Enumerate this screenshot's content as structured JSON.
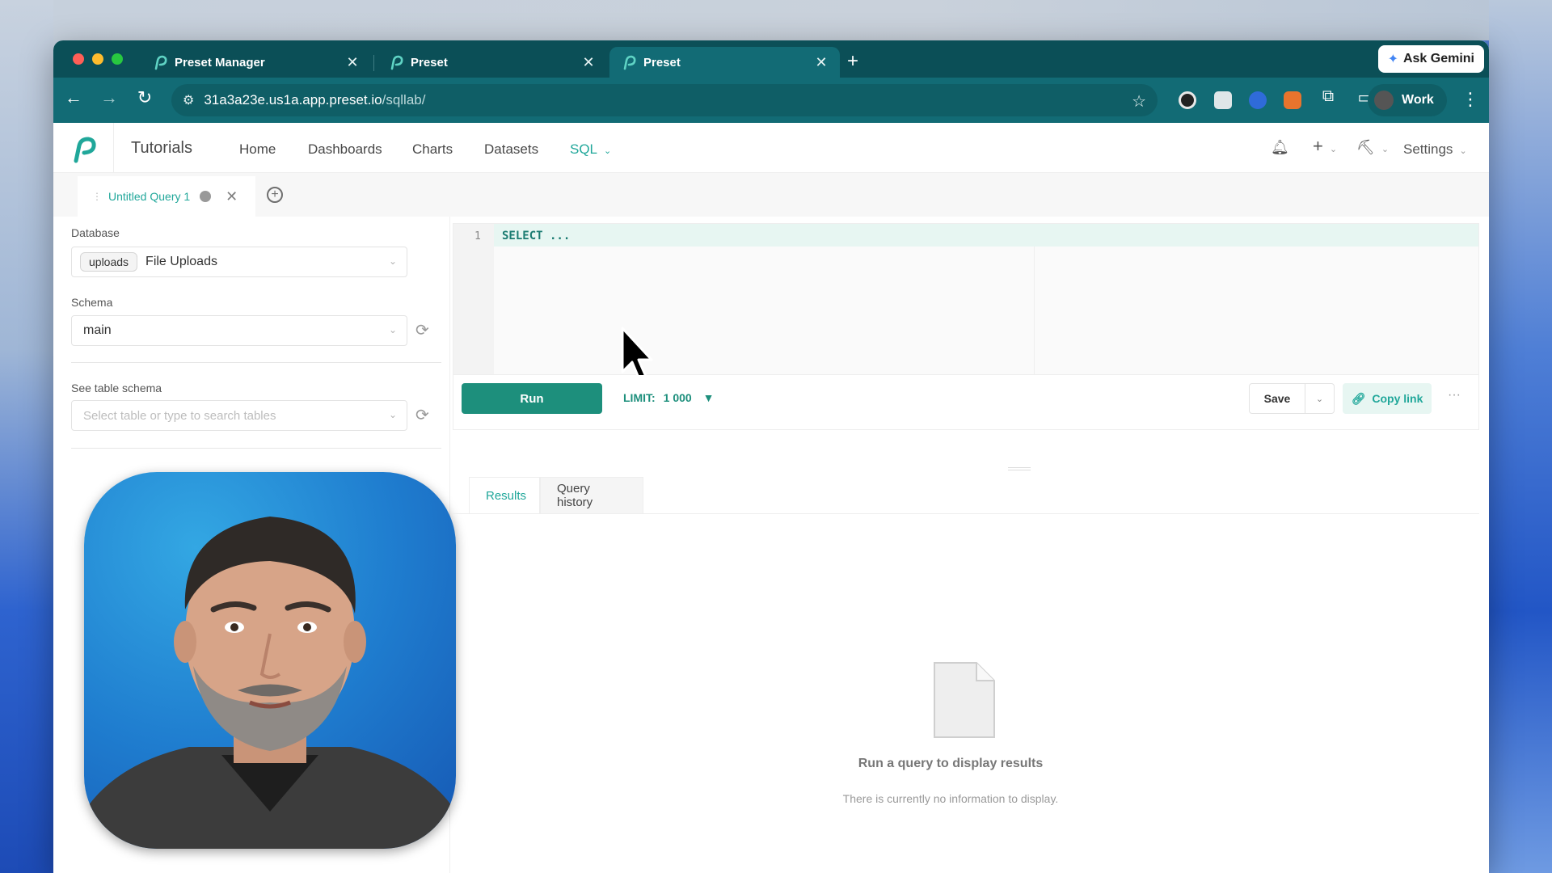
{
  "browser": {
    "tabs": [
      {
        "title": "Preset Manager",
        "active": false
      },
      {
        "title": "Preset",
        "active": false
      },
      {
        "title": "Preset",
        "active": true
      }
    ],
    "new_tab": "+",
    "ask_gemini": "Ask Gemini",
    "url_host": "31a3a23e.us1a.app.preset.io",
    "url_path": "/sqllab/",
    "profile_label": "Work"
  },
  "app": {
    "brand": "Tutorials",
    "nav": [
      {
        "label": "Home"
      },
      {
        "label": "Dashboards"
      },
      {
        "label": "Charts"
      },
      {
        "label": "Datasets"
      },
      {
        "label": "SQL",
        "active": true
      }
    ],
    "settings_label": "Settings",
    "colors": {
      "accent": "#20a79a",
      "run_button": "#1d8f7c",
      "browser_chrome": "#126b75"
    }
  },
  "query_tab": {
    "title": "Untitled Query 1"
  },
  "left_panel": {
    "database_label": "Database",
    "database_pill": "uploads",
    "database_value": "File Uploads",
    "schema_label": "Schema",
    "schema_value": "main",
    "table_schema_label": "See table schema",
    "table_placeholder": "Select table or type to search tables"
  },
  "editor": {
    "line_number": "1",
    "code": "SELECT ..."
  },
  "actions": {
    "run": "Run",
    "limit_label": "LIMIT:",
    "limit_value": "1 000",
    "save": "Save",
    "copy_link": "Copy link",
    "more": "···"
  },
  "results": {
    "tabs": [
      "Results",
      "Query history"
    ],
    "empty_title": "Run a query to display results",
    "empty_subtitle": "There is currently no information to display."
  }
}
